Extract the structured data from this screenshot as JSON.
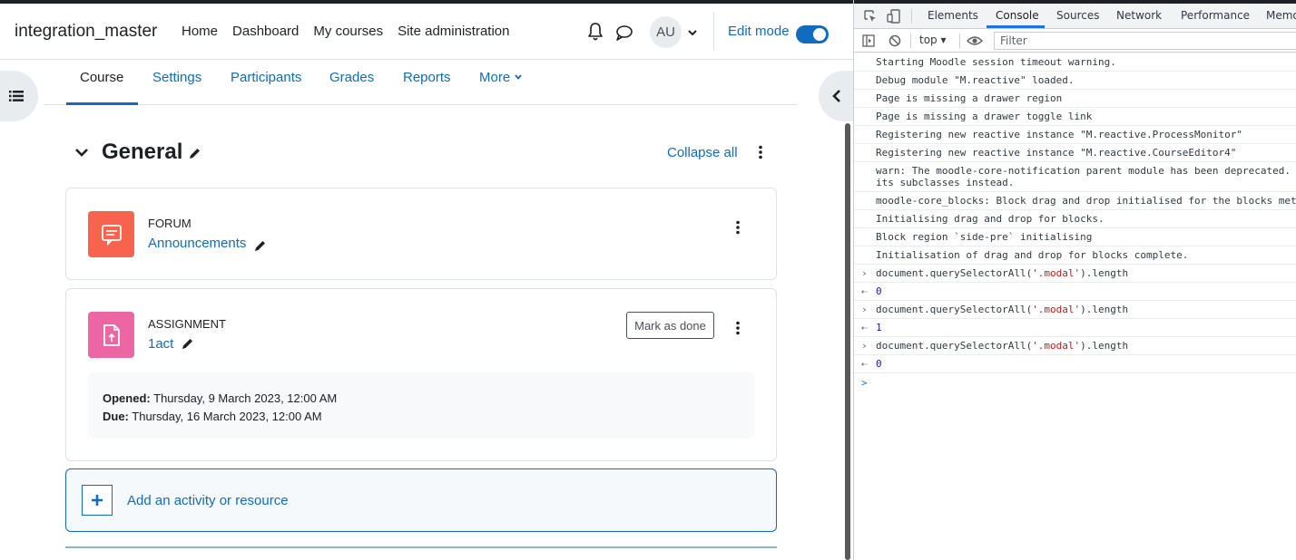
{
  "moodle": {
    "brand": "integration_master",
    "nav": {
      "home": "Home",
      "dashboard": "Dashboard",
      "my_courses": "My courses",
      "site_admin": "Site administration"
    },
    "avatar_initials": "AU",
    "edit_mode_label": "Edit mode",
    "edit_mode_on": true,
    "tabs": {
      "course": "Course",
      "settings": "Settings",
      "participants": "Participants",
      "grades": "Grades",
      "reports": "Reports",
      "more": "More"
    },
    "section": {
      "title": "General",
      "collapse_all": "Collapse all"
    },
    "activities": {
      "forum": {
        "type": "FORUM",
        "name": "Announcements",
        "color": "#f7634d"
      },
      "assignment": {
        "type": "ASSIGNMENT",
        "name": "1act",
        "color": "#eb66a2",
        "mark_done": "Mark as done",
        "opened_label": "Opened:",
        "opened_value": "Thursday, 9 March 2023, 12:00 AM",
        "due_label": "Due:",
        "due_value": "Thursday, 16 March 2023, 12:00 AM"
      }
    },
    "add_activity": "Add an activity or resource"
  },
  "devtools": {
    "tabs": {
      "elements": "Elements",
      "console": "Console",
      "sources": "Sources",
      "network": "Network",
      "performance": "Performance",
      "memory": "Memo"
    },
    "context": "top",
    "filter_placeholder": "Filter",
    "logs": [
      "Starting Moodle session timeout warning.",
      "Debug module \"M.reactive\" loaded.",
      "Page is missing a drawer region",
      "Page is missing a drawer toggle link",
      "Registering new reactive instance \"M.reactive.ProcessMonitor\"",
      "Registering new reactive instance \"M.reactive.CourseEditor4\"",
      "warn: The moodle-core-notification parent module has been deprecated. Please use one of\nits subclasses instead.",
      "moodle-core_blocks: Block drag and drop initialised for the blocks method.",
      "Initialising drag and drop for blocks.",
      "Block region `side-pre` initialising",
      "Initialisation of drag and drop for blocks complete."
    ],
    "commands": [
      {
        "pre": "document.querySelectorAll(",
        "str": "'.modal'",
        "post": ").length",
        "result": "0"
      },
      {
        "pre": "document.querySelectorAll(",
        "str": "'.modal'",
        "post": ").length",
        "result": "1"
      },
      {
        "pre": "document.querySelectorAll(",
        "str": "'.modal'",
        "post": ").length",
        "result": "0"
      }
    ],
    "prompt_symbol": ">"
  }
}
